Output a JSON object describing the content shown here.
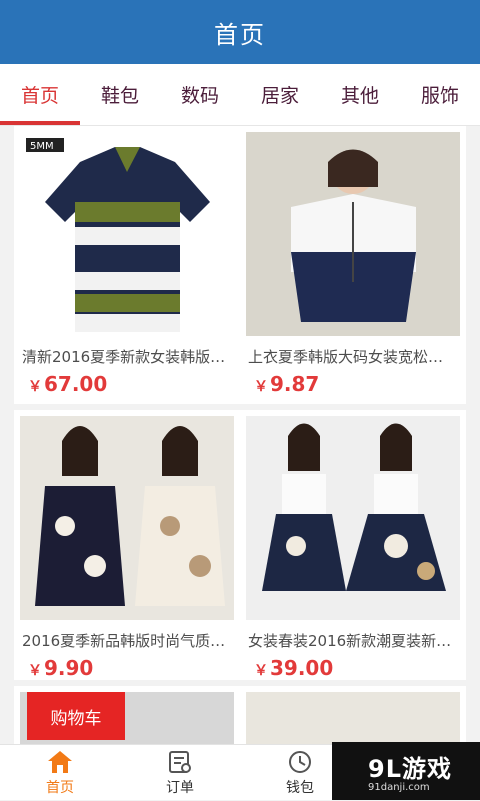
{
  "header": {
    "title": "首页"
  },
  "tabs": [
    {
      "label": "首页"
    },
    {
      "label": "鞋包"
    },
    {
      "label": "数码"
    },
    {
      "label": "居家"
    },
    {
      "label": "其他"
    },
    {
      "label": "服饰"
    }
  ],
  "products": [
    {
      "title": "清新2016夏季新款女装韩版…",
      "price": "67.00",
      "currency": "￥"
    },
    {
      "title": "上衣夏季韩版大码女装宽松…",
      "price": "9.87",
      "currency": "￥"
    },
    {
      "title": "2016夏季新品韩版时尚气质…",
      "price": "9.90",
      "currency": "￥"
    },
    {
      "title": "女装春装2016新款潮夏装新…",
      "price": "39.00",
      "currency": "￥"
    }
  ],
  "image_badge": "5MM",
  "cart_chip": "购物车",
  "bottom_nav": [
    {
      "label": "首页",
      "icon": "home-icon"
    },
    {
      "label": "订单",
      "icon": "order-icon"
    },
    {
      "label": "钱包",
      "icon": "wallet-icon"
    }
  ],
  "watermark": {
    "main": "9L游戏",
    "sub": "91danji.com"
  },
  "colors": {
    "primary": "#2a73b8",
    "accent": "#d93434",
    "nav_active": "#f27a16"
  }
}
